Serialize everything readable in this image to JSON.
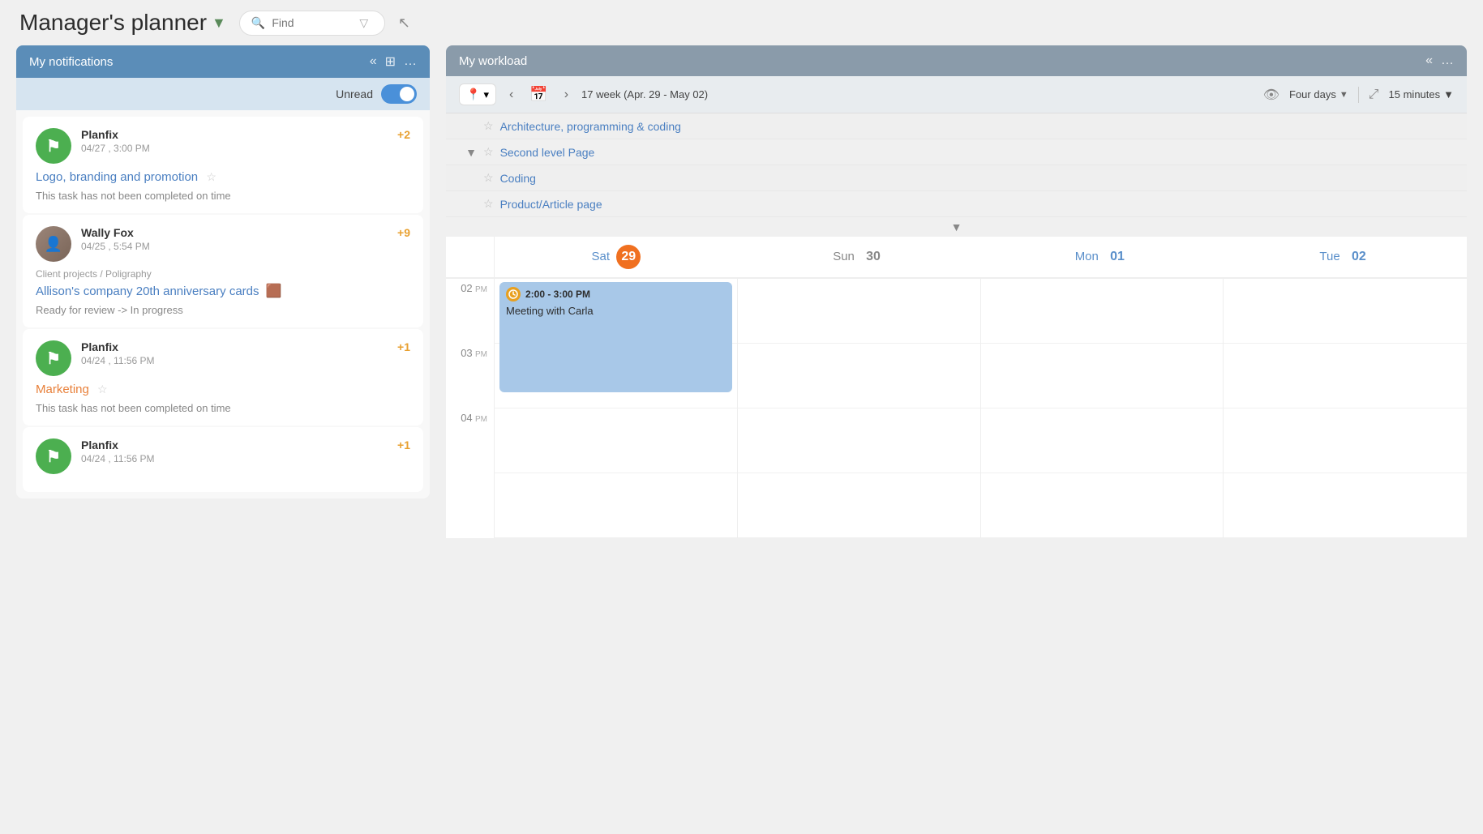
{
  "app": {
    "title": "Manager's planner",
    "dropdown_icon": "▼",
    "search_placeholder": "Find",
    "cursor_visible": true
  },
  "notifications_panel": {
    "title": "My notifications",
    "collapse_icon": "«",
    "grid_icon": "⊞",
    "more_icon": "…",
    "unread_label": "Unread",
    "toggle_active": true,
    "items": [
      {
        "sender": "Planfix",
        "time": "04/27 , 3:00 PM",
        "badge": "+2",
        "avatar_type": "planfix",
        "task_link": "Logo, branding and promotion",
        "has_star": true,
        "description": "This task has not been completed on time",
        "path": ""
      },
      {
        "sender": "Wally Fox",
        "time": "04/25 , 5:54 PM",
        "badge": "+9",
        "avatar_type": "wally",
        "task_link": "Allison's company 20th anniversary cards",
        "has_emoji": true,
        "emoji": "🟫",
        "description": "Ready for review -> In progress",
        "path": "Client projects / Poligraphy"
      },
      {
        "sender": "Planfix",
        "time": "04/24 , 11:56 PM",
        "badge": "+1",
        "avatar_type": "planfix",
        "task_link": "Marketing",
        "has_star": true,
        "task_link_color": "orange",
        "description": "This task has not been completed on time",
        "path": ""
      },
      {
        "sender": "Planfix",
        "time": "04/24 , 11:56 PM",
        "badge": "+1",
        "avatar_type": "planfix",
        "task_link": "",
        "description": "",
        "path": ""
      }
    ]
  },
  "workload_panel": {
    "title": "My workload",
    "collapse_icon": "«",
    "more_icon": "…",
    "location_icon": "📍",
    "prev_icon": "‹",
    "next_icon": "›",
    "calendar_icon": "📅",
    "week_label": "17 week (Apr. 29 - May 02)",
    "view_label": "Four days",
    "view_dropdown": "▼",
    "time_label": "15 minutes",
    "time_dropdown": "▼",
    "tasks": [
      {
        "name": "Architecture, programming & coding",
        "star": "☆"
      },
      {
        "name": "Second level Page",
        "star": "☆",
        "expandable": true
      },
      {
        "name": "Coding",
        "star": "☆"
      },
      {
        "name": "Product/Article page",
        "star": "☆"
      }
    ],
    "calendar": {
      "days": [
        {
          "label": "Sat",
          "num": "29",
          "is_today": true,
          "color": "sat"
        },
        {
          "label": "Sun",
          "num": "30",
          "is_today": false,
          "color": "sun"
        },
        {
          "label": "Mon",
          "num": "01",
          "is_today": false,
          "color": "mon"
        },
        {
          "label": "Tue",
          "num": "02",
          "is_today": false,
          "color": "tue"
        }
      ],
      "time_slots": [
        "02",
        "03",
        "04"
      ],
      "events": [
        {
          "day_index": 0,
          "top_offset": 0,
          "height": 130,
          "time": "2:00 - 3:00 PM",
          "title": "Meeting with Carla"
        }
      ]
    }
  }
}
